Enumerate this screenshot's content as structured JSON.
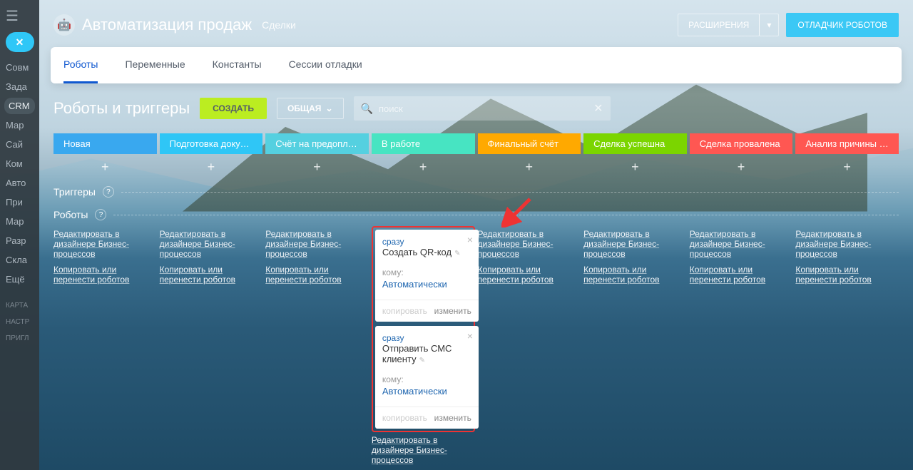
{
  "sidebar": {
    "items": [
      "Совм",
      "Зада",
      "CRM",
      "Мар",
      "Сай",
      "Ком",
      "Авто",
      "При",
      "Мар",
      "Разр",
      "Скла",
      "Ещё"
    ],
    "active": 2,
    "footer": [
      "КАРТА",
      "НАСТР",
      "ПРИГЛ"
    ]
  },
  "header": {
    "title": "Автоматизация продаж",
    "sub": "Сделки",
    "extensions": "РАСШИРЕНИЯ",
    "debugger": "ОТЛАДЧИК РОБОТОВ"
  },
  "tabs": {
    "items": [
      "Роботы",
      "Переменные",
      "Константы",
      "Сессии отладки"
    ],
    "active": 0
  },
  "toolbar": {
    "title": "Роботы и триггеры",
    "create": "СОЗДАТЬ",
    "common": "ОБЩАЯ",
    "search_ph": "поиск"
  },
  "stages": [
    {
      "label": "Новая",
      "color": "#39a8ef"
    },
    {
      "label": "Подготовка документов",
      "color": "#2fc6f6"
    },
    {
      "label": "Счёт на предоплату",
      "color": "#55d0e0"
    },
    {
      "label": "В работе",
      "color": "#47e4c2"
    },
    {
      "label": "Финальный счёт",
      "color": "#ffa900"
    },
    {
      "label": "Сделка успешна",
      "color": "#7bd500"
    },
    {
      "label": "Сделка провалена",
      "color": "#ff5752"
    },
    {
      "label": "Анализ причины пр...",
      "color": "#ff5752"
    }
  ],
  "sections": {
    "triggers": "Триггеры",
    "robots": "Роботы"
  },
  "links": {
    "design": "Редактировать в дизайнере Бизнес-процессов",
    "copy": "Копировать или перенести роботов"
  },
  "cards": [
    {
      "when": "сразу",
      "title": "Создать QR-код",
      "whom": "кому:",
      "auto": "Автоматически",
      "copy": "копировать",
      "edit": "изменить"
    },
    {
      "when": "сразу",
      "title": "Отправить СМС клиенту",
      "whom": "кому:",
      "auto": "Автоматически",
      "copy": "копировать",
      "edit": "изменить"
    }
  ]
}
